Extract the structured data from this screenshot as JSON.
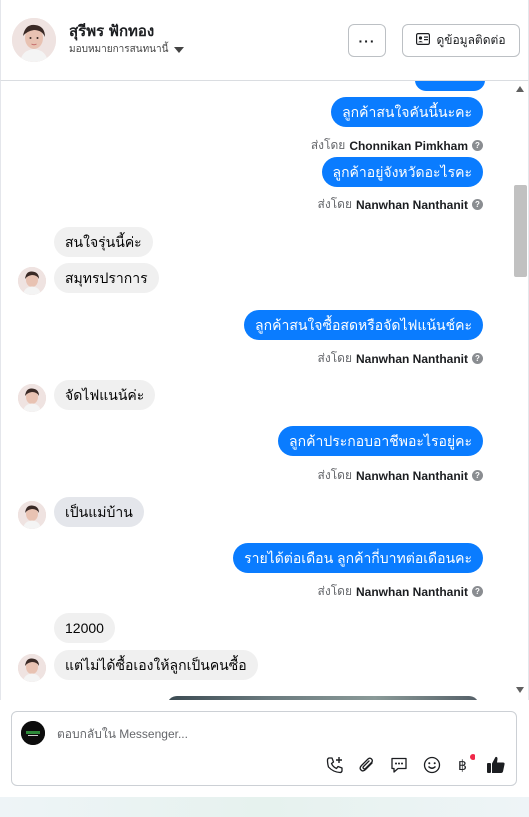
{
  "header": {
    "contact_name": "สุรีพร ฟักทอง",
    "assign_label": "มอบหมายการสนทนานี้",
    "more_label": "···",
    "view_contact_label": "ดูข้อมูลติดต่อ"
  },
  "messages": {
    "m1": "ลูกค้าสนใจคันนี้นะคะ",
    "m1_sent_prefix": "ส่งโดย",
    "m1_sender": "Chonnikan Pimkham",
    "m2": "ลูกค้าอยู่จังหวัดอะไรคะ",
    "m2_sent_prefix": "ส่งโดย",
    "m2_sender": "Nanwhan Nanthanit",
    "m3": "สนใจรุ่นนี้ค่ะ",
    "m4": "สมุทรปราการ",
    "m5": "ลูกค้าสนใจซื้อสดหรือจัดไฟแน้นช์คะ",
    "m5_sent_prefix": "ส่งโดย",
    "m5_sender": "Nanwhan Nanthanit",
    "m6": "จัดไฟแนน้ค่ะ",
    "m7": "ลูกค้าประกอบอาชีพอะไรอยู่คะ",
    "m7_sent_prefix": "ส่งโดย",
    "m7_sender": "Nanwhan Nanthanit",
    "m8": "เป็นแม่บ้าน",
    "m9": "รายได้ต่อเดือน ลูกค้ากี่บาทต่อเดือนคะ",
    "m9_sent_prefix": "ส่งโดย",
    "m9_sender": "Nanwhan Nanthanit",
    "m10": "12000",
    "m11": "แต่ไม่ได้ซื้อเองให้ลูกเป็นคนซื้อ",
    "help_glyph": "?"
  },
  "composer": {
    "placeholder": "ตอบกลับใน Messenger..."
  },
  "icons": {
    "header": [
      "more-icon",
      "contact-card-icon",
      "chevron-down-icon"
    ],
    "composer": [
      "call-add-icon",
      "attachment-icon",
      "saved-reply-icon",
      "emoji-icon",
      "baht-payment-icon",
      "thumbs-up-icon"
    ]
  },
  "colors": {
    "outgoing_bubble": "#0a7cff",
    "incoming_bubble": "#f0f0f0",
    "notification_dot": "#f02849",
    "text_secondary": "#65676b"
  }
}
